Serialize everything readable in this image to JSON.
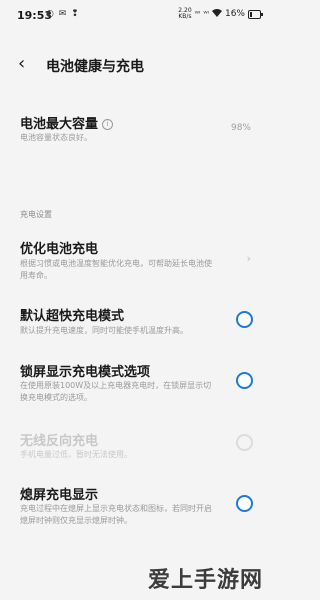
{
  "status_bar": {
    "time": "19:53",
    "left_icons": "◐ ✉ ❢",
    "net_speed_top": "2.20",
    "net_speed_bottom": "KB/s",
    "signal_1": "ᵂᴵ",
    "signal_2": "ᵂᴵ",
    "battery_percent": "16%"
  },
  "header": {
    "back_icon": "‹",
    "title": "电池健康与充电"
  },
  "capacity": {
    "title": "电池最大容量",
    "desc": "电池容量状态良好。",
    "value": "98%"
  },
  "section": {
    "label": "充电设置"
  },
  "rows": [
    {
      "title": "优化电池充电",
      "desc": "根据习惯或电池温度智能优化充电，可帮助延长电池使用寿命。",
      "control": "chevron"
    },
    {
      "title": "默认超快充电模式",
      "desc": "默认提升充电速度，同时可能使手机温度升高。",
      "control": "toggle-on"
    },
    {
      "title": "锁屏显示充电模式选项",
      "desc": "在使用原装100W及以上充电器充电时，在锁屏显示切换充电模式的选项。",
      "control": "toggle-on"
    },
    {
      "title": "无线反向充电",
      "desc": "手机电量过低，暂时无法使用。",
      "control": "toggle-off"
    },
    {
      "title": "熄屏充电显示",
      "desc": "充电过程中在熄屏上显示充电状态和图标，若同时开启熄屏时钟则仅充显示熄屏时钟。",
      "control": "toggle-on"
    }
  ],
  "watermark": "爱上手游网",
  "colors": {
    "accent": "#1e7ad6",
    "background": "#f4f4f4"
  }
}
